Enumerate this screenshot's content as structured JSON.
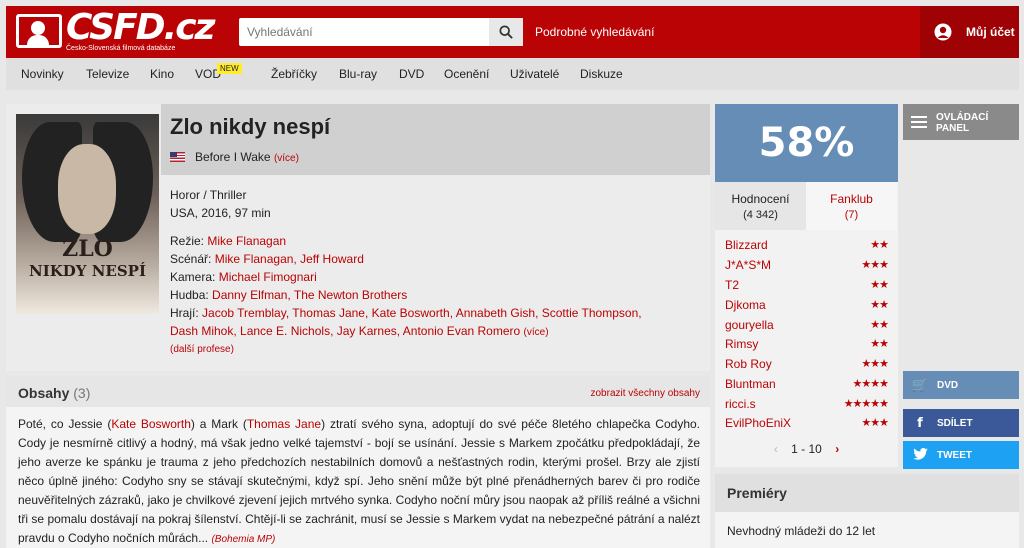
{
  "header": {
    "logo_text": "CSFD.cz",
    "logo_subtitle": "Česko-Slovenská filmová databáze",
    "search_placeholder": "Vyhledávání",
    "advanced_search": "Podrobné vyhledávání",
    "account": "Můj účet",
    "colors": {
      "brand": "#ba0305"
    }
  },
  "nav": {
    "items": [
      "Novinky",
      "Televize",
      "Kino",
      "VOD",
      "Žebříčky",
      "Blu-ray",
      "DVD",
      "Ocenění",
      "Uživatelé",
      "Diskuze"
    ],
    "vod_badge": "NEW"
  },
  "film": {
    "title": "Zlo nikdy nespí",
    "poster_title_line1": "ZLO",
    "poster_title_line2": "NIKDY NESPÍ",
    "original_title": "Before I Wake",
    "original_more": "(více)",
    "flag_icon": "usa-flag-icon",
    "genre": "Horor / Thriller",
    "origin": "USA, 2016, 97 min",
    "director_label": "Režie:",
    "director": "Mike Flanagan",
    "writer_label": "Scénář:",
    "writers": "Mike Flanagan, Jeff Howard",
    "camera_label": "Kamera:",
    "camera": "Michael Fimognari",
    "music_label": "Hudba:",
    "music": "Danny Elfman, The Newton Brothers",
    "cast_label": "Hrají:",
    "cast_line1": "Jacob Tremblay, Thomas Jane, Kate Bosworth, Annabeth Gish, Scottie Thompson,",
    "cast_line2": "Dash Mihok, Lance E. Nichols, Jay Karnes, Antonio Evan Romero",
    "cast_more": "(více)",
    "other_professions": "(další profese)"
  },
  "plot": {
    "title": "Obsahy",
    "count": "(3)",
    "show_all": "zobrazit všechny obsahy",
    "part1": "Poté, co Jessie (",
    "actor1": "Kate Bosworth",
    "part2": ") a Mark (",
    "actor2": "Thomas Jane",
    "part3": ") ztratí svého syna, adoptují do své péče 8letého chlapečka Codyho. Cody je nesmírně citlivý a hodný, má však jedno velké tajemství - bojí se usínání. Jessie s Markem zpočátku předpokládají, že jeho averze ke spánku je trauma z jeho předchozích nestabilních domovů a nešťastných rodin, kterými prošel. Brzy ale zjistí něco úplně jiného: Codyho sny se stávají skutečnými, když spí. Jeho snění může být plné přenádherných barev či pro rodiče neuvěřitelných zázraků, jako je chvilkové zjevení jejich mrtvého synka. Codyho noční můry jsou naopak až příliš reálné a všichni tři se pomalu dostávají na pokraj šílenství. Chtějí-li se zachránit, musí se Jessie s Markem vydat na nebezpečné pátrání a nalézt pravdu o Codyho nočních můrách...",
    "source": "(Bohemia MP)"
  },
  "rating": {
    "percent": "58%",
    "tab_ratings": "Hodnocení",
    "tab_ratings_count": "(4 342)",
    "tab_fanclub": "Fanklub",
    "tab_fanclub_count": "(7)",
    "users": [
      {
        "name": "Blizzard",
        "stars": "★★"
      },
      {
        "name": "J*A*S*M",
        "stars": "★★★"
      },
      {
        "name": "T2",
        "stars": "★★"
      },
      {
        "name": "Djkoma",
        "stars": "★★"
      },
      {
        "name": "gouryella",
        "stars": "★★"
      },
      {
        "name": "Rimsy",
        "stars": "★★"
      },
      {
        "name": "Rob Roy",
        "stars": "★★★"
      },
      {
        "name": "Bluntman",
        "stars": "★★★★"
      },
      {
        "name": "ricci.s",
        "stars": "★★★★★"
      },
      {
        "name": "EvilPhoEniX",
        "stars": "★★★"
      }
    ],
    "pager": "1 - 10",
    "colors": {
      "rating_bg": "#658db5"
    }
  },
  "side": {
    "control_panel_line1": "OVLÁDACÍ",
    "control_panel_line2": "PANEL",
    "dvd": "DVD",
    "share": "SDÍLET",
    "tweet": "TWEET"
  },
  "premiere": {
    "title": "Premiéry",
    "text": "Nevhodný mládeži do 12 let"
  }
}
